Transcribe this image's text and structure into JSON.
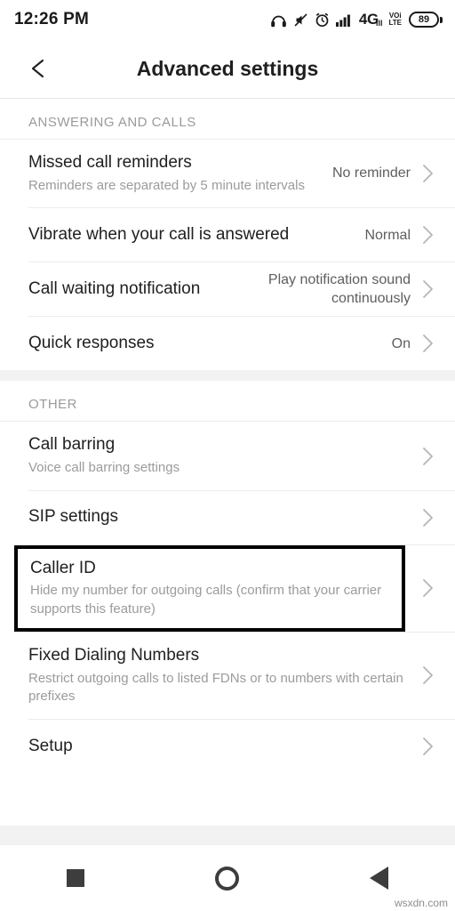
{
  "status_bar": {
    "time": "12:26 PM",
    "battery_percent": "89",
    "network": "4G",
    "network_sub": "lll",
    "volte_top": "VOi",
    "volte_bottom": "LTE",
    "icons": [
      "headphones-icon",
      "mute-icon",
      "alarm-icon",
      "signal-bars-icon",
      "network-4g-icon",
      "volte-icon",
      "battery-icon"
    ]
  },
  "app_bar": {
    "title": "Advanced settings",
    "back_icon": "back-arrow-icon"
  },
  "sections": [
    {
      "header": "ANSWERING AND CALLS",
      "rows": [
        {
          "title": "Missed call reminders",
          "subtitle": "Reminders are separated by 5 minute intervals",
          "value": "No reminder"
        },
        {
          "title": "Vibrate when your call is answered",
          "subtitle": "",
          "value": "Normal"
        },
        {
          "title": "Call waiting notification",
          "subtitle": "",
          "value": "Play notification sound continuously"
        },
        {
          "title": "Quick responses",
          "subtitle": "",
          "value": "On"
        }
      ]
    },
    {
      "header": "OTHER",
      "rows": [
        {
          "title": "Call barring",
          "subtitle": "Voice call barring settings",
          "value": ""
        },
        {
          "title": "SIP settings",
          "subtitle": "",
          "value": ""
        },
        {
          "title": "Caller ID",
          "subtitle": "Hide my number for outgoing calls (confirm that your carrier supports this feature)",
          "value": "",
          "highlighted": true
        },
        {
          "title": "Fixed Dialing Numbers",
          "subtitle": "Restrict outgoing calls to listed FDNs or to numbers with certain prefixes",
          "value": ""
        },
        {
          "title": "Setup",
          "subtitle": "",
          "value": ""
        }
      ]
    }
  ],
  "nav_bar": {
    "recents_label": "recents-button",
    "home_label": "home-button",
    "back_label": "back-button"
  },
  "watermark": "wsxdn.com",
  "colors": {
    "accent": "#000000",
    "text_primary": "#202020",
    "text_secondary": "#9b9b9b",
    "divider": "#ececec",
    "band": "#f2f2f2"
  }
}
